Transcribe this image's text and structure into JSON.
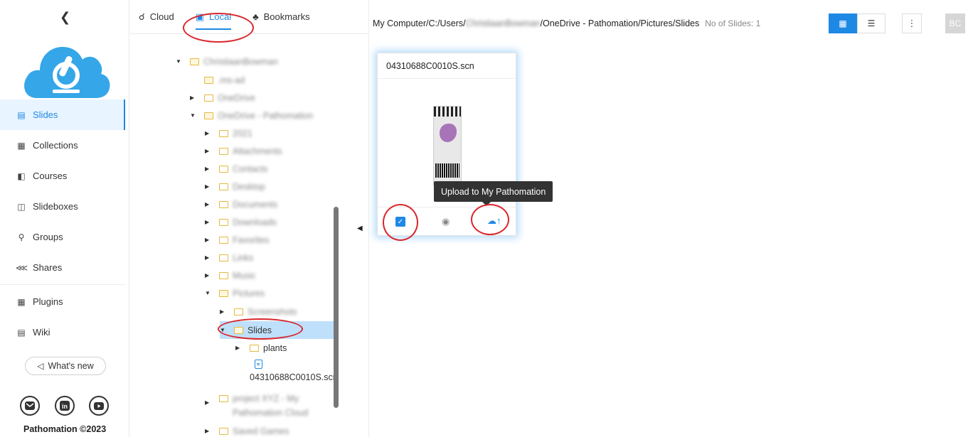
{
  "sidebar": {
    "collapse_icon": "chevron-left-icon",
    "items": [
      {
        "label": "Slides",
        "icon": "image-icon",
        "active": true
      },
      {
        "label": "Collections",
        "icon": "collection-icon"
      },
      {
        "label": "Courses",
        "icon": "book-icon"
      },
      {
        "label": "Slideboxes",
        "icon": "slidebox-icon"
      },
      {
        "label": "Groups",
        "icon": "group-icon"
      },
      {
        "label": "Shares",
        "icon": "share-icon"
      },
      {
        "label": "Plugins",
        "icon": "plugin-icon"
      },
      {
        "label": "Wiki",
        "icon": "wiki-icon"
      }
    ],
    "whats_new": "What's new",
    "footer": "Pathomation ©2023",
    "accent": "#1e88e5"
  },
  "tree_panel": {
    "tabs": [
      {
        "label": "Cloud",
        "icon": "cloud-icon"
      },
      {
        "label": "Local",
        "icon": "laptop-icon",
        "active": true
      },
      {
        "label": "Bookmarks",
        "icon": "bookmark-icon"
      }
    ],
    "nodes": [
      {
        "label": "ChristiaanBowman",
        "blurred": true
      },
      {
        "label": ".ms-ad",
        "blurred": true
      },
      {
        "label": "OneDrive",
        "blurred": true
      },
      {
        "label": "OneDrive - Pathomation",
        "blurred": true
      },
      {
        "label": "2021",
        "blurred": true
      },
      {
        "label": "Attachments",
        "blurred": true
      },
      {
        "label": "Contacts",
        "blurred": true
      },
      {
        "label": "Desktop",
        "blurred": true
      },
      {
        "label": "Documents",
        "blurred": true
      },
      {
        "label": "Downloads",
        "blurred": true
      },
      {
        "label": "Favorites",
        "blurred": true
      },
      {
        "label": "Links",
        "blurred": true
      },
      {
        "label": "Music",
        "blurred": true
      },
      {
        "label": "Pictures",
        "blurred": true
      },
      {
        "label": "Screenshots",
        "blurred": true
      },
      {
        "label": "Slides",
        "blurred": false
      },
      {
        "label": "plants",
        "blurred": false
      },
      {
        "label": "project XYZ - My Pathomation Cloud",
        "blurred": true
      },
      {
        "label": "Saved Games",
        "blurred": true
      }
    ],
    "file": {
      "name": "04310688C0010S.scn"
    }
  },
  "main": {
    "breadcrumb": {
      "prefix": "My Computer/C:/Users/",
      "hidden_user": "ChristiaanBowman",
      "suffix": "/OneDrive - Pathomation/Pictures/Slides",
      "count": "No of Slides: 1"
    },
    "avatar": "BC",
    "menu_icon": "more-vertical-icon",
    "card": {
      "title": "04310688C0010S.scn",
      "tooltip": "Upload to My Pathomation",
      "checked": true
    }
  }
}
